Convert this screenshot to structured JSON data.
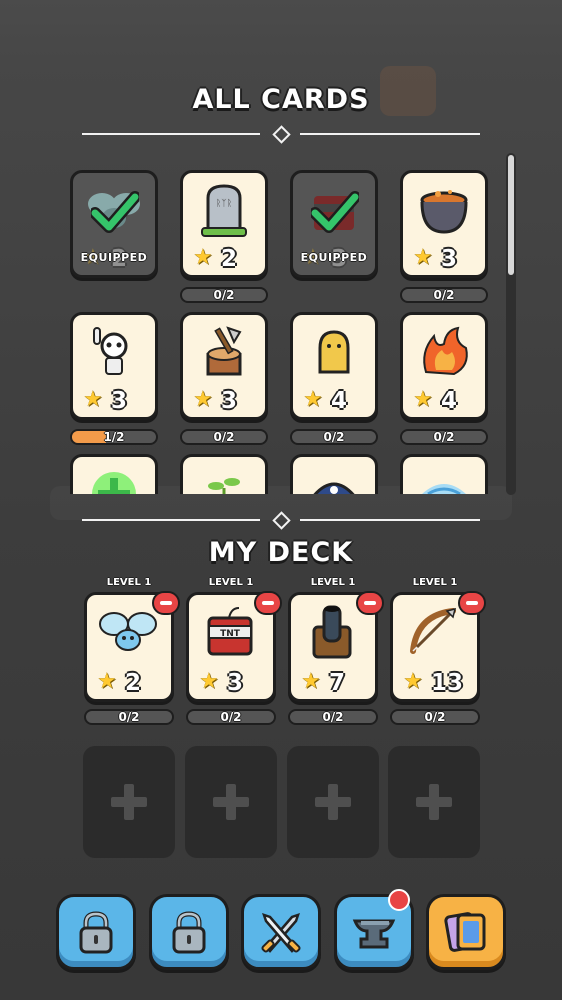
{
  "all_cards": {
    "title": "ALL CARDS",
    "cards": [
      {
        "name": "spider",
        "level": "2",
        "equipped": true,
        "equipped_label": "EQUIPPED",
        "progress": null
      },
      {
        "name": "gravestone",
        "level": "2",
        "equipped": false,
        "progress": "0/2",
        "fill": 0
      },
      {
        "name": "tnt",
        "level": "3",
        "equipped": true,
        "equipped_label": "EQUIPPED",
        "progress": null
      },
      {
        "name": "cauldron",
        "level": "3",
        "equipped": false,
        "progress": "0/2",
        "fill": 0
      },
      {
        "name": "skeleton",
        "level": "3",
        "equipped": false,
        "progress": "1/2",
        "fill": 0.5
      },
      {
        "name": "axe-stump",
        "level": "3",
        "equipped": false,
        "progress": "0/2",
        "fill": 0
      },
      {
        "name": "yellow-ghost",
        "level": "4",
        "equipped": false,
        "progress": "0/2",
        "fill": 0
      },
      {
        "name": "fire-hand",
        "level": "4",
        "equipped": false,
        "progress": "0/2",
        "fill": 0
      },
      {
        "name": "heal",
        "level": "",
        "equipped": false,
        "progress": null
      },
      {
        "name": "sprout",
        "level": "",
        "equipped": false,
        "progress": null
      },
      {
        "name": "pirate-hat",
        "level": "",
        "equipped": false,
        "progress": null
      },
      {
        "name": "ice-wind",
        "level": "",
        "equipped": false,
        "progress": null
      }
    ]
  },
  "my_deck": {
    "title": "MY DECK",
    "cards": [
      {
        "name": "spider",
        "level_label": "LEVEL 1",
        "level": "2",
        "progress": "0/2"
      },
      {
        "name": "tnt",
        "level_label": "LEVEL 1",
        "level": "3",
        "progress": "0/2"
      },
      {
        "name": "cannon",
        "level_label": "LEVEL 1",
        "level": "7",
        "progress": "0/2"
      },
      {
        "name": "bow",
        "level_label": "LEVEL 1",
        "level": "13",
        "progress": "0/2"
      }
    ],
    "empty_slots": 4
  },
  "nav": [
    {
      "name": "locked-1",
      "icon": "lock-icon",
      "active": false
    },
    {
      "name": "locked-2",
      "icon": "lock-icon",
      "active": false
    },
    {
      "name": "battle",
      "icon": "swords-icon",
      "active": false
    },
    {
      "name": "forge",
      "icon": "anvil-icon",
      "active": false,
      "notification": true
    },
    {
      "name": "cards",
      "icon": "cards-icon",
      "active": true
    }
  ],
  "colors": {
    "accent": "#f7b245",
    "button": "#5bb6e8",
    "card_bg": "#fdf4df",
    "progress_fill": "#f39b4a",
    "badge": "#e84545"
  }
}
